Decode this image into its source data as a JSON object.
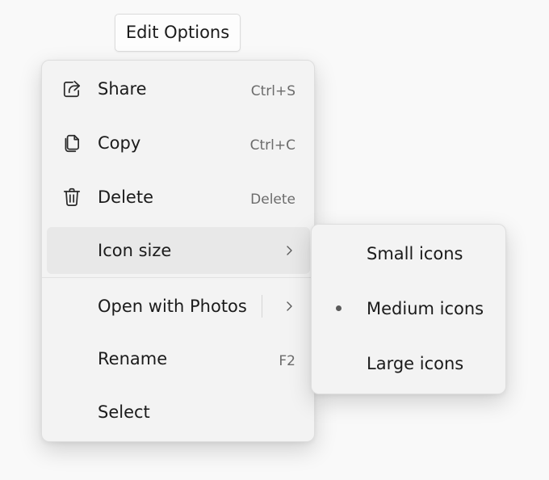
{
  "trigger": {
    "label": "Edit Options"
  },
  "menu": {
    "items": [
      {
        "label": "Share",
        "accelerator": "Ctrl+S",
        "icon": "share-icon"
      },
      {
        "label": "Copy",
        "accelerator": "Ctrl+C",
        "icon": "copy-icon"
      },
      {
        "label": "Delete",
        "accelerator": "Delete",
        "icon": "trash-icon"
      },
      {
        "label": "Icon size",
        "icon": "chevron-right-icon",
        "state": "hover"
      },
      {
        "label": "Open with Photos",
        "icon": "chevron-right-icon"
      },
      {
        "label": "Rename",
        "accelerator": "F2"
      },
      {
        "label": "Select"
      }
    ]
  },
  "submenu": {
    "items": [
      {
        "label": "Small icons",
        "selected": false
      },
      {
        "label": "Medium icons",
        "selected": true
      },
      {
        "label": "Large icons",
        "selected": false
      }
    ]
  },
  "colors": {
    "background": "#f9f9f9",
    "menu_background": "#f3f3f3",
    "hover_background": "#e8e8e8",
    "text": "#1b1b1b",
    "accelerator_text": "#6b6b6b"
  }
}
